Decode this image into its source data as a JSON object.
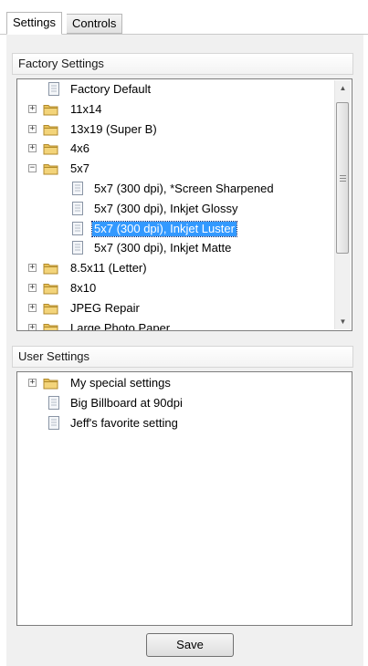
{
  "tabs": [
    {
      "label": "Settings",
      "active": true
    },
    {
      "label": "Controls",
      "active": false
    }
  ],
  "factory": {
    "header": "Factory Settings",
    "items": [
      {
        "label": "Factory Default",
        "icon": "document-icon"
      },
      {
        "label": "11x14",
        "icon": "folder-icon",
        "expander": "+"
      },
      {
        "label": "13x19 (Super B)",
        "icon": "folder-icon",
        "expander": "+"
      },
      {
        "label": "4x6",
        "icon": "folder-icon",
        "expander": "+"
      },
      {
        "label": "5x7",
        "icon": "folder-icon",
        "expander": "-"
      },
      {
        "label": "5x7 (300 dpi), *Screen Sharpened",
        "icon": "document-icon"
      },
      {
        "label": "5x7 (300 dpi), Inkjet Glossy",
        "icon": "document-icon"
      },
      {
        "label": "5x7 (300 dpi), Inkjet Luster",
        "icon": "document-icon",
        "selected": true
      },
      {
        "label": "5x7 (300 dpi), Inkjet Matte",
        "icon": "document-icon"
      },
      {
        "label": "8.5x11 (Letter)",
        "icon": "folder-icon",
        "expander": "+"
      },
      {
        "label": "8x10",
        "icon": "folder-icon",
        "expander": "+"
      },
      {
        "label": "JPEG Repair",
        "icon": "folder-icon",
        "expander": "+"
      },
      {
        "label": "Large Photo Paper",
        "icon": "folder-icon",
        "expander": "+"
      }
    ]
  },
  "user": {
    "header": "User Settings",
    "items": [
      {
        "label": "My special settings",
        "icon": "folder-icon",
        "expander": "+"
      },
      {
        "label": "Big Billboard at 90dpi",
        "icon": "document-icon"
      },
      {
        "label": "Jeff's favorite setting",
        "icon": "document-icon"
      }
    ]
  },
  "save_label": "Save",
  "colors": {
    "selection": "#3399ff",
    "folder": "#e8c25a",
    "panel": "#f0f0f0"
  }
}
